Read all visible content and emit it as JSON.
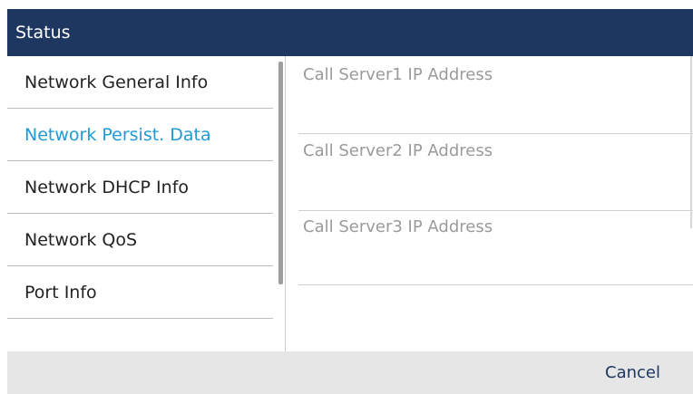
{
  "header": {
    "title": "Status"
  },
  "menu": {
    "items": [
      {
        "label": "Network General Info"
      },
      {
        "label": "Network Persist. Data",
        "selected": true
      },
      {
        "label": "Network DHCP Info"
      },
      {
        "label": "Network QoS"
      },
      {
        "label": "Port Info"
      }
    ]
  },
  "details": {
    "fields": [
      {
        "label": "Call Server1 IP Address",
        "value": ""
      },
      {
        "label": "Call Server2 IP Address",
        "value": ""
      },
      {
        "label": "Call Server3 IP Address",
        "value": ""
      }
    ]
  },
  "footer": {
    "cancel_label": "Cancel"
  },
  "colors": {
    "header_bg": "#1e3760",
    "selected_text": "#1f9ad6",
    "footer_bg": "#e6e6e6"
  }
}
